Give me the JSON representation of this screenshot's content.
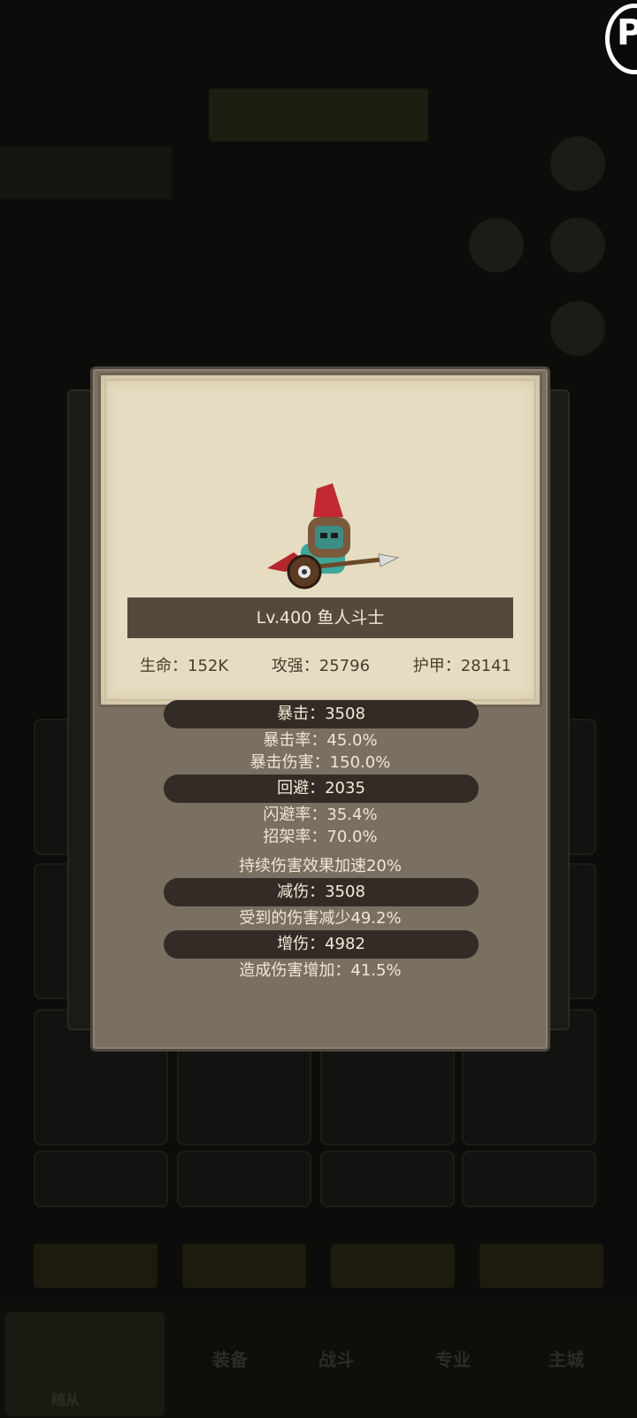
{
  "background": {
    "banner_title": "",
    "nav": {
      "items": [
        "装备",
        "战斗",
        "专业",
        "主城"
      ],
      "active_label": "随从"
    }
  },
  "modal": {
    "name": "Lv.400 鱼人斗士",
    "stats": {
      "hp": "生命：152K",
      "atk": "攻强：25796",
      "armor": "护甲：28141"
    },
    "crit_header": "暴击：3508",
    "crit_rate": "暴击率：45.0%",
    "crit_damage": "暴击伤害：150.0%",
    "dodge_header": "回避：2035",
    "dodge_rate": "闪避率：35.4%",
    "parry_rate": "招架率：70.0%",
    "dot_speed": "持续伤害效果加速20%",
    "reduce_header": "减伤：3508",
    "reduce_text": "受到的伤害减少49.2%",
    "increase_header": "增伤：4982",
    "increase_text": "造成伤害增加：41.5%"
  },
  "colors": {
    "modal_bg": "#7a7062",
    "parchment": "#e6dcc1",
    "pill": "#332c26",
    "name_bar": "#55493c"
  }
}
